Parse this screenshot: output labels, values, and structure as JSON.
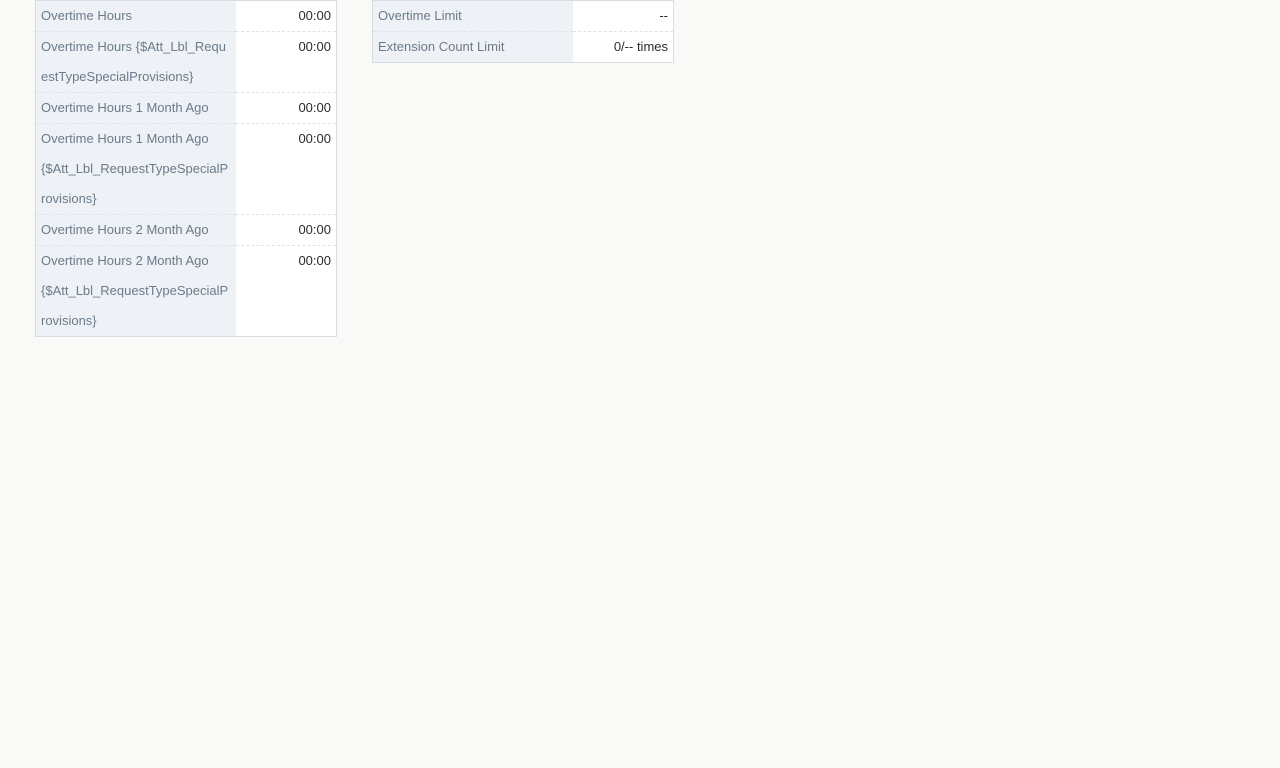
{
  "left_table": {
    "rows": [
      {
        "label": "Overtime Hours",
        "value": "00:00"
      },
      {
        "label": "Overtime Hours {$Att_Lbl_RequestTypeSpecialProvisions}",
        "value": "00:00"
      },
      {
        "label": "Overtime Hours 1 Month Ago",
        "value": "00:00"
      },
      {
        "label": "Overtime Hours 1 Month Ago {$Att_Lbl_RequestTypeSpecialProvisions}",
        "value": "00:00"
      },
      {
        "label": "Overtime Hours 2 Month Ago",
        "value": "00:00"
      },
      {
        "label": "Overtime Hours 2 Month Ago {$Att_Lbl_RequestTypeSpecialProvisions}",
        "value": "00:00"
      }
    ]
  },
  "right_table": {
    "rows": [
      {
        "label": "Overtime Limit",
        "value": "--"
      },
      {
        "label": "Extension Count Limit",
        "value": "0/-- times"
      }
    ]
  }
}
